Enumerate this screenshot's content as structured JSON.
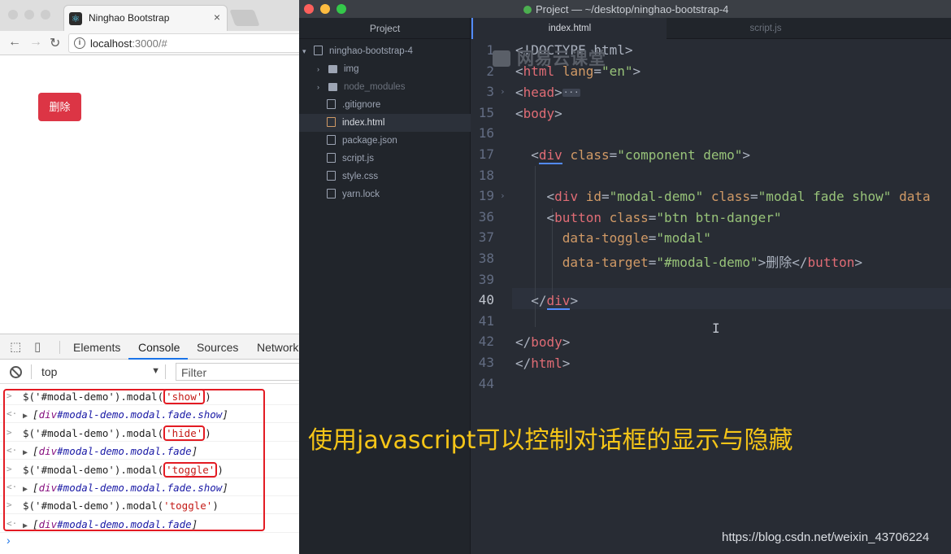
{
  "browser": {
    "tab_title": "Ninghao Bootstrap",
    "url_host": "localhost",
    "url_rest": ":3000/#",
    "page_button": "删除"
  },
  "devtools": {
    "tabs": [
      "Elements",
      "Console",
      "Sources",
      "Network"
    ],
    "active_tab": "Console",
    "context": "top",
    "filter_placeholder": "Filter",
    "console": [
      {
        "kind": "input",
        "code": "$('#modal-demo').modal(",
        "arg": "'show'",
        "close": ")"
      },
      {
        "kind": "result",
        "tag": "div",
        "id": "#modal-demo",
        "cls": ".modal.fade.show"
      },
      {
        "kind": "input",
        "code": "$('#modal-demo').modal(",
        "arg": "'hide'",
        "close": ")"
      },
      {
        "kind": "result",
        "tag": "div",
        "id": "#modal-demo",
        "cls": ".modal.fade"
      },
      {
        "kind": "input",
        "code": "$('#modal-demo').modal(",
        "arg": "'toggle'",
        "close": ")"
      },
      {
        "kind": "result",
        "tag": "div",
        "id": "#modal-demo",
        "cls": ".modal.fade.show"
      },
      {
        "kind": "input",
        "code": "$('#modal-demo').modal(",
        "arg": "'toggle'",
        "close": ")"
      },
      {
        "kind": "result",
        "tag": "div",
        "id": "#modal-demo",
        "cls": ".modal.fade"
      }
    ]
  },
  "editor": {
    "window_title": "Project — ~/desktop/ninghao-bootstrap-4",
    "tree_header": "Project",
    "root_folder": "ninghao-bootstrap-4",
    "tree": [
      {
        "name": "img",
        "type": "folder"
      },
      {
        "name": "node_modules",
        "type": "folder"
      },
      {
        "name": ".gitignore",
        "type": "file"
      },
      {
        "name": "index.html",
        "type": "file"
      },
      {
        "name": "package.json",
        "type": "file"
      },
      {
        "name": "script.js",
        "type": "file"
      },
      {
        "name": "style.css",
        "type": "file"
      },
      {
        "name": "yarn.lock",
        "type": "file"
      }
    ],
    "tabs": [
      "index.html",
      "script.js"
    ],
    "active_tab": "index.html",
    "line_numbers": [
      "1",
      "2",
      "3",
      "15",
      "16",
      "17",
      "18",
      "19",
      "36",
      "37",
      "38",
      "39",
      "40",
      "41",
      "42",
      "43",
      "44"
    ],
    "current_line": "40"
  },
  "overlay": {
    "watermark": "网易云课堂",
    "caption": "使用javascript可以控制对话框的显示与隐藏",
    "credit": "https://blog.csdn.net/weixin_43706224"
  },
  "colors": {
    "danger": "#dc3545",
    "caption": "#f5c518",
    "highlight_box": "#e31b23",
    "devtools_active": "#1a73e8"
  }
}
